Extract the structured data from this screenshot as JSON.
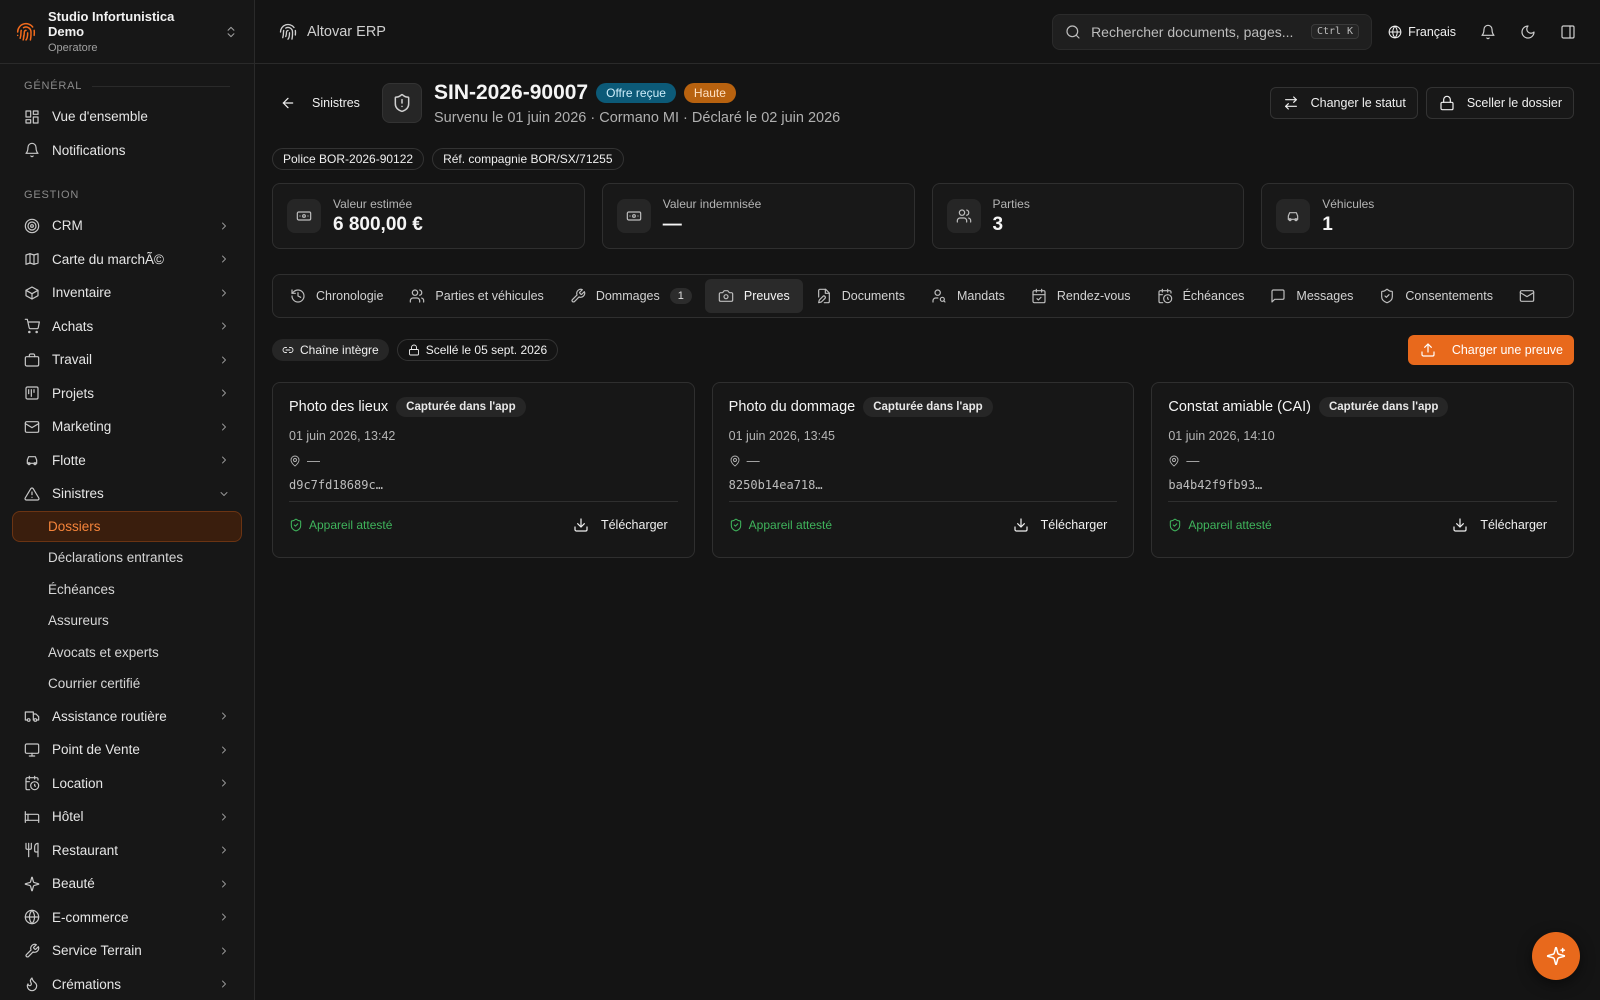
{
  "org": {
    "name": "Studio Infortunistica Demo",
    "role": "Operatore"
  },
  "nav": {
    "section_general": "GÉNÉRAL",
    "section_gestion": "GESTION",
    "general": [
      {
        "label": "Vue d'ensemble",
        "icon": "grid-icon"
      },
      {
        "label": "Notifications",
        "icon": "bell-icon"
      }
    ],
    "gestion": [
      {
        "label": "CRM",
        "icon": "target-icon"
      },
      {
        "label": "Carte du marchÃ©",
        "icon": "map-icon"
      },
      {
        "label": "Inventaire",
        "icon": "box-icon"
      },
      {
        "label": "Achats",
        "icon": "cart-icon"
      },
      {
        "label": "Travail",
        "icon": "briefcase-icon"
      },
      {
        "label": "Projets",
        "icon": "project-icon"
      },
      {
        "label": "Marketing",
        "icon": "mail-icon"
      },
      {
        "label": "Flotte",
        "icon": "car-icon"
      },
      {
        "label": "Sinistres",
        "icon": "warning-icon"
      }
    ],
    "sinistres_sub": [
      "Dossiers",
      "Déclarations entrantes",
      "Échéances",
      "Assureurs",
      "Avocats et experts",
      "Courrier certifié"
    ],
    "more": [
      {
        "label": "Assistance routière",
        "icon": "truck-icon"
      },
      {
        "label": "Point de Vente",
        "icon": "monitor-icon"
      },
      {
        "label": "Location",
        "icon": "calendar-clock-icon"
      },
      {
        "label": "Hôtel",
        "icon": "hotel-icon"
      },
      {
        "label": "Restaurant",
        "icon": "utensils-icon"
      },
      {
        "label": "Beauté",
        "icon": "sparkle-icon"
      },
      {
        "label": "E-commerce",
        "icon": "globe-icon"
      },
      {
        "label": "Service Terrain",
        "icon": "wrench-icon"
      },
      {
        "label": "Crémations",
        "icon": "flame-icon"
      }
    ]
  },
  "topbar": {
    "app_name": "Altovar ERP",
    "search_placeholder": "Rechercher documents, pages...",
    "shortcut": "Ctrl K",
    "language": "Français"
  },
  "claim": {
    "back_label": "Sinistres",
    "id": "SIN-2026-90007",
    "status": "Offre reçue",
    "priority": "Haute",
    "subtitle": "Survenu le 01 juin 2026 · Cormano MI · Déclaré le 02 juin 2026",
    "change_status_label": "Changer le statut",
    "seal_label": "Sceller le dossier",
    "policy_ref": "Police BOR-2026-90122",
    "company_ref": "Réf. compagnie BOR/SX/71255"
  },
  "stats": [
    {
      "label": "Valeur estimée",
      "value": "6 800,00 €",
      "icon": "banknote-icon"
    },
    {
      "label": "Valeur indemnisée",
      "value": "—",
      "icon": "banknote-icon"
    },
    {
      "label": "Parties",
      "value": "3",
      "icon": "users-icon"
    },
    {
      "label": "Véhicules",
      "value": "1",
      "icon": "car-icon"
    }
  ],
  "tabs": [
    {
      "label": "Chronologie",
      "icon": "history-icon"
    },
    {
      "label": "Parties et véhicules",
      "icon": "users-icon"
    },
    {
      "label": "Dommages",
      "icon": "wrench-icon",
      "count": "1"
    },
    {
      "label": "Preuves",
      "icon": "camera-icon",
      "active": true
    },
    {
      "label": "Documents",
      "icon": "file-edit-icon"
    },
    {
      "label": "Mandats",
      "icon": "user-key-icon"
    },
    {
      "label": "Rendez-vous",
      "icon": "calendar-check-icon"
    },
    {
      "label": "Échéances",
      "icon": "calendar-clock-icon"
    },
    {
      "label": "Messages",
      "icon": "message-icon"
    },
    {
      "label": "Consentements",
      "icon": "shield-check-icon"
    },
    {
      "label": "",
      "icon": "mail-icon"
    }
  ],
  "evidence": {
    "chain_label": "Chaîne intègre",
    "sealed_label": "Scellé le 05 sept. 2026",
    "upload_label": "Charger une preuve",
    "items": [
      {
        "title": "Photo des lieux",
        "badge": "Capturée dans l'app",
        "date": "01 juin 2026, 13:42",
        "location": "—",
        "hash": "d9c7fd18689c…",
        "attest": "Appareil attesté",
        "download": "Télécharger"
      },
      {
        "title": "Photo du dommage",
        "badge": "Capturée dans l'app",
        "date": "01 juin 2026, 13:45",
        "location": "—",
        "hash": "8250b14ea718…",
        "attest": "Appareil attesté",
        "download": "Télécharger"
      },
      {
        "title": "Constat amiable (CAI)",
        "badge": "Capturée dans l'app",
        "date": "01 juin 2026, 14:10",
        "location": "—",
        "hash": "ba4b42f9fb93…",
        "attest": "Appareil attesté",
        "download": "Télécharger"
      }
    ]
  },
  "colors": {
    "accent": "#e8691c",
    "status_blue": "#0c5a78",
    "priority_orange": "#b8620f",
    "success": "#3fb45c"
  }
}
